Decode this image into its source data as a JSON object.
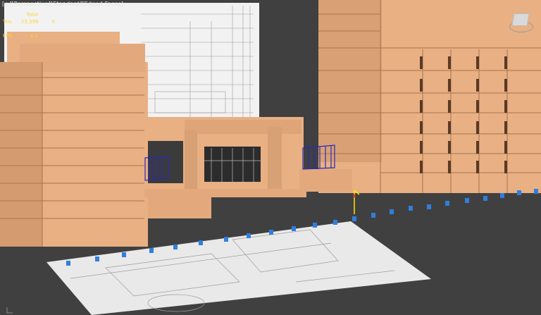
{
  "viewport": {
    "label_parts": [
      "+",
      "Perspective",
      "Standard",
      "Edged Faces"
    ],
    "label_sep_open": "[",
    "label_sep_close": "]"
  },
  "stats": {
    "total_label": "Total",
    "tris_label": "Tris:",
    "tris_total": "25,399",
    "tris_selected": "0",
    "fps_label": "FPS:",
    "fps_value": "4.5"
  },
  "colors": {
    "background": "#404040",
    "building": "#e8b083",
    "building_shadow": "#c9926a",
    "railing": "#2a2ab8",
    "marker": "#2f7fdc",
    "plan_sheet": "#e6e6e6",
    "stats_text": "#ffd23c"
  },
  "icons": {
    "viewcube": "viewcube-icon",
    "gizmo": "transform-gizmo-icon",
    "marker": "light-marker-icon"
  }
}
